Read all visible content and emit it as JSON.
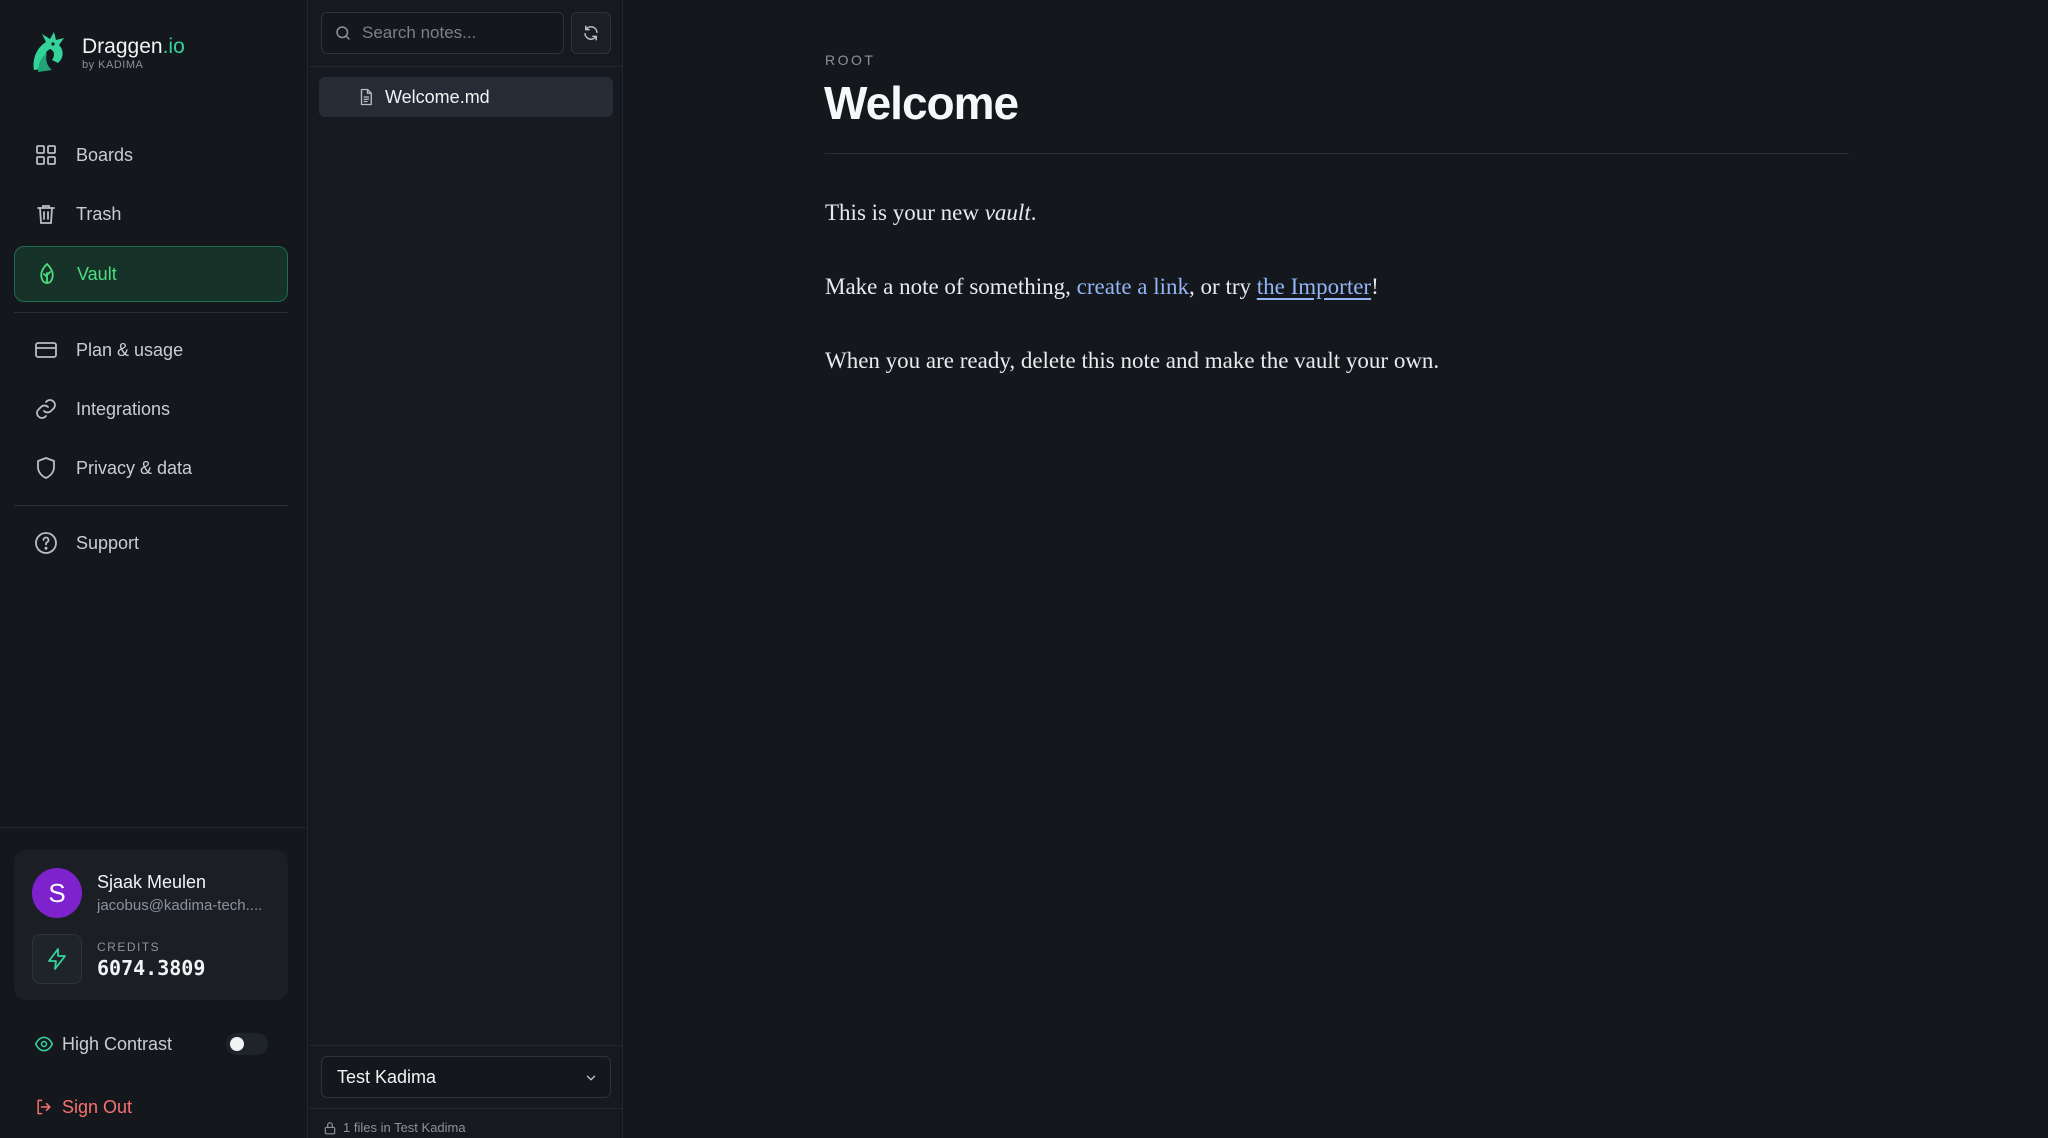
{
  "brand": {
    "name": "Draggen",
    "tld": ".io",
    "sub": "by KADIMA"
  },
  "nav": {
    "primary": [
      {
        "label": "Boards",
        "icon": "grid-icon"
      },
      {
        "label": "Trash",
        "icon": "trash-icon"
      },
      {
        "label": "Vault",
        "icon": "leaf-icon",
        "active": true
      }
    ],
    "secondary": [
      {
        "label": "Plan & usage",
        "icon": "card-icon"
      },
      {
        "label": "Integrations",
        "icon": "link-icon"
      },
      {
        "label": "Privacy & data",
        "icon": "shield-icon"
      }
    ],
    "support": {
      "label": "Support",
      "icon": "help-icon"
    }
  },
  "user": {
    "initial": "S",
    "name": "Sjaak Meulen",
    "email": "jacobus@kadima-tech....",
    "credits_label": "CREDITS",
    "credits_value": "6074.3809"
  },
  "settings": {
    "high_contrast_label": "High Contrast",
    "high_contrast_on": false
  },
  "signout_label": "Sign Out",
  "notes": {
    "search_placeholder": "Search notes...",
    "files": [
      {
        "name": "Welcome.md"
      }
    ],
    "vault_selected": "Test Kadima",
    "file_count": "1 files in Test Kadima"
  },
  "document": {
    "breadcrumb": "ROOT",
    "title": "Welcome",
    "p1_before": "This is your new ",
    "p1_em": "vault",
    "p1_after": ".",
    "p2_before": "Make a note of something, ",
    "p2_link1": "create a link",
    "p2_mid": ", or try ",
    "p2_link2": "the Importer",
    "p2_after": "!",
    "p3": "When you are ready, delete this note and make the vault your own."
  },
  "colors": {
    "accent": "#4ade80",
    "brand_green": "#34d399",
    "danger": "#f87171",
    "link": "#93b4f5",
    "avatar": "#7e22ce"
  }
}
